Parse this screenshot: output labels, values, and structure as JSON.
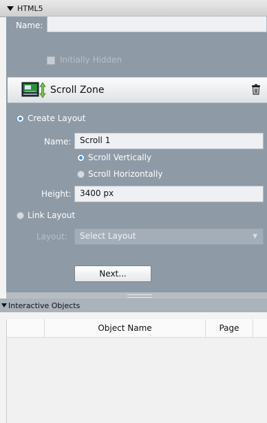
{
  "header": {
    "title": "HTML5"
  },
  "panel": {
    "name_label": "Name:",
    "name_value": "",
    "initially_hidden_label": "Initially Hidden",
    "scroll_zone_title": "Scroll Zone",
    "create_layout_label": "Create Layout",
    "layout_name_label": "Name:",
    "layout_name_value": "Scroll 1",
    "scroll_vertical_label": "Scroll Vertically",
    "scroll_horizontal_label": "Scroll Horizontally",
    "height_label": "Height:",
    "height_value": "3400 px",
    "link_layout_label": "Link Layout",
    "layout_label": "Layout:",
    "layout_select_value": "Select Layout",
    "next_button": "Next..."
  },
  "interactive_objects": {
    "title": "Interactive Objects",
    "columns": [
      "",
      "Object Name",
      "Page"
    ]
  },
  "colors": {
    "panel": "#8e9aa6",
    "radio_selected": "#3d8fe0"
  }
}
